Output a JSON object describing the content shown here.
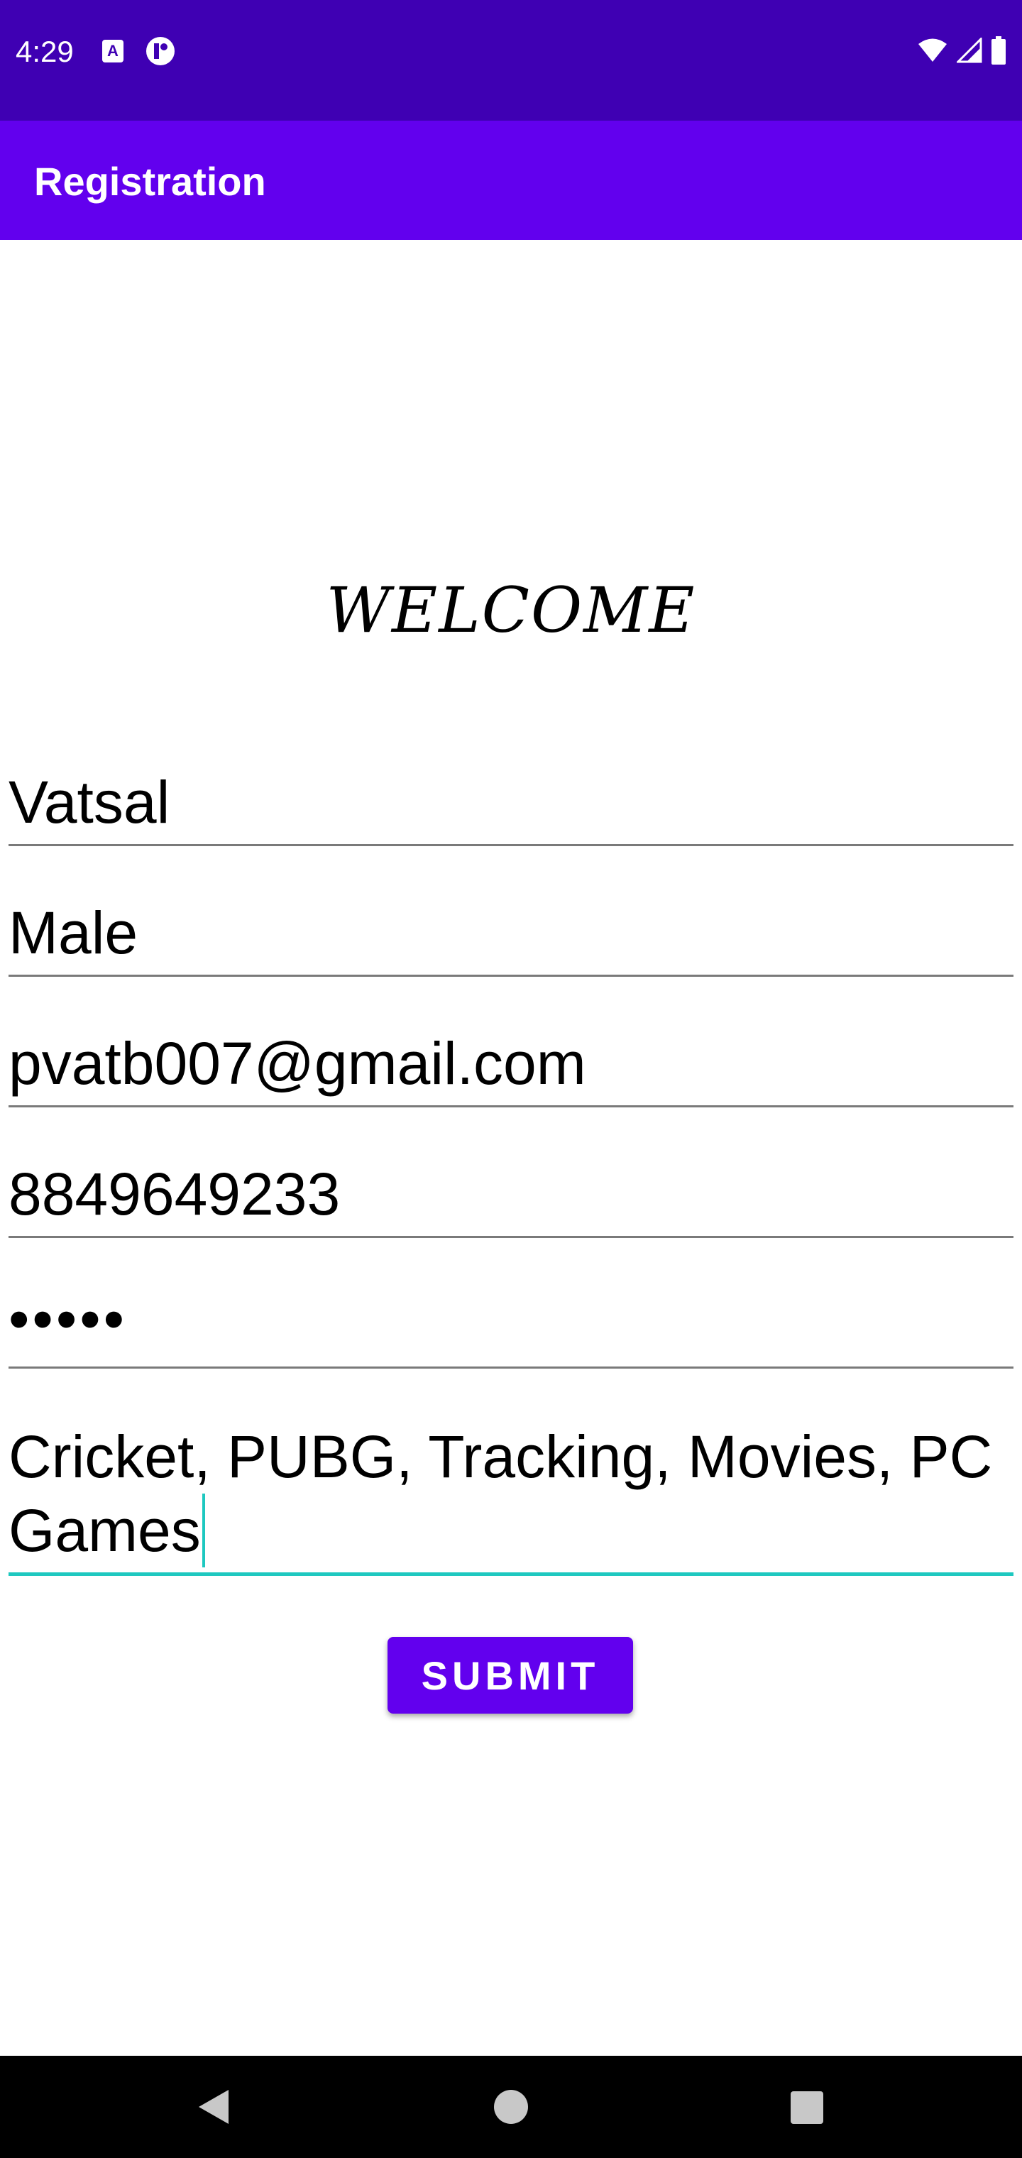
{
  "status_bar": {
    "time": "4:29",
    "left_icons": [
      "keyboard-a-icon",
      "app-notification-icon"
    ],
    "right_icons": [
      "wifi-icon",
      "cell-signal-icon",
      "battery-icon"
    ],
    "background": "#3f00b3"
  },
  "app_bar": {
    "title": "Registration",
    "background": "#6200ee"
  },
  "welcome": {
    "text": "WELCOME"
  },
  "form": {
    "name_value": "Vatsal",
    "gender_value": "Male",
    "email_value": "pvatb007@gmail.com",
    "phone_value": "8849649233",
    "password_value": "•••••",
    "hobbies_value": "Cricket, PUBG, Tracking, Movies, PC Games",
    "focus_color": "#1ec8c0"
  },
  "submit": {
    "label": "SUBMIT",
    "background": "#6200ee"
  },
  "nav_bar": {
    "icons": [
      "back-icon",
      "home-icon",
      "recent-apps-icon"
    ]
  }
}
